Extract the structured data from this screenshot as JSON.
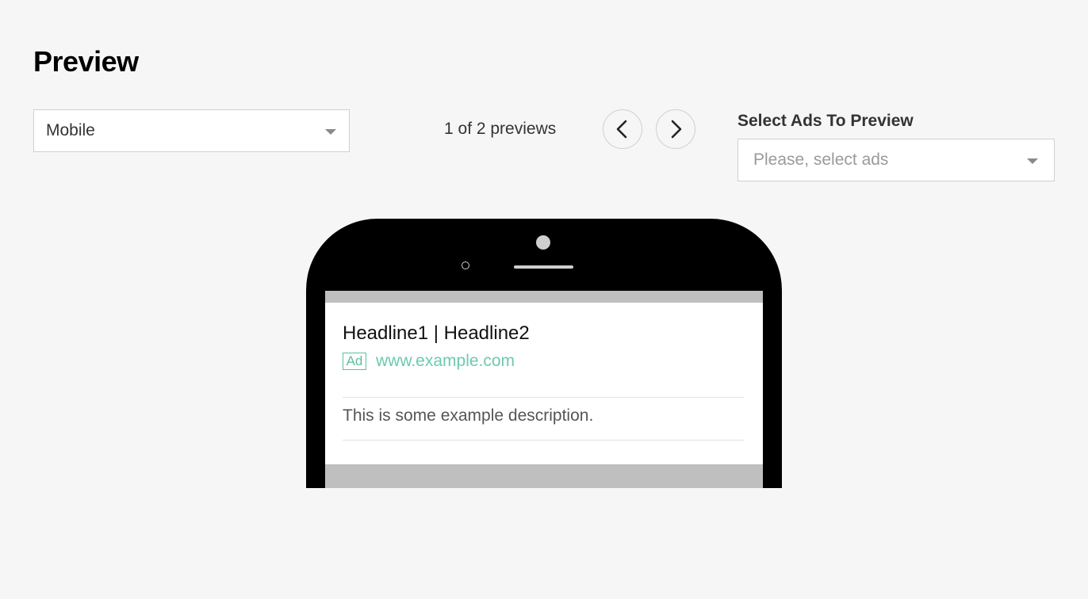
{
  "page": {
    "title": "Preview"
  },
  "device_select": {
    "value": "Mobile"
  },
  "pagination": {
    "counter_text": "1 of 2 previews",
    "prev_icon": "chevron-left-icon",
    "next_icon": "chevron-right-icon"
  },
  "ads_select": {
    "label": "Select Ads To Preview",
    "placeholder": "Please, select ads"
  },
  "ad_preview": {
    "headline": "Headline1 | Headline2",
    "badge": "Ad",
    "url": "www.example.com",
    "description": "This is some example description."
  },
  "colors": {
    "accent": "#6ccab0",
    "background": "#f6f6f6",
    "phone_body": "#000000",
    "screen_frame": "#bfbfbf"
  }
}
